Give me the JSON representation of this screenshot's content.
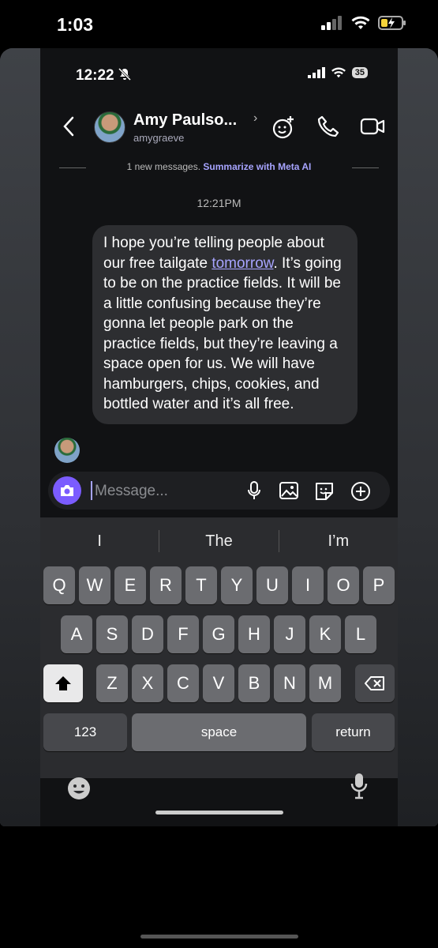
{
  "outer_status": {
    "time": "1:03"
  },
  "inner_status": {
    "time": "12:22",
    "battery": "35"
  },
  "header": {
    "name": "Amy Paulso...",
    "handle": "amygraeve"
  },
  "notice": {
    "text": "1 new messages.",
    "action": "Summarize with Meta AI"
  },
  "timestamp": "12:21PM",
  "message": {
    "pre": "I hope you’re telling people about our free tailgate ",
    "link": "tomorrow",
    "post": ". It’s going to be on the practice fields. It will be a little confusing because they’re gonna let people park on the practice fields, but they’re leaving a space open for us. We will have hamburgers, chips, cookies, and bottled water and it’s all free."
  },
  "composer": {
    "placeholder": "Message..."
  },
  "keyboard": {
    "suggestions": [
      "I",
      "The",
      "I’m"
    ],
    "row1": [
      "Q",
      "W",
      "E",
      "R",
      "T",
      "Y",
      "U",
      "I",
      "O",
      "P"
    ],
    "row2": [
      "A",
      "S",
      "D",
      "F",
      "G",
      "H",
      "J",
      "K",
      "L"
    ],
    "row3": [
      "Z",
      "X",
      "C",
      "V",
      "B",
      "N",
      "M"
    ],
    "numbers_label": "123",
    "space_label": "space",
    "return_label": "return"
  },
  "colors": {
    "accent": "#a7a4ff",
    "camera": "#7b5cff",
    "bubble": "#2d2e31"
  }
}
